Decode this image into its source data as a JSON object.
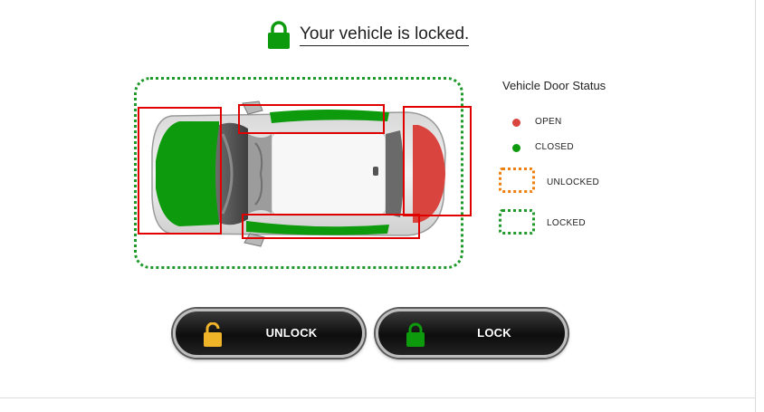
{
  "header": {
    "status_text": "Your vehicle is locked."
  },
  "legend": {
    "title": "Vehicle Door Status",
    "open_label": "OPEN",
    "closed_label": "CLOSED",
    "unlocked_label": "UNLOCKED",
    "locked_label": "LOCKED"
  },
  "colors": {
    "open": "#d9443f",
    "closed": "#0d9a0d",
    "unlocked": "#ee7f0e",
    "locked": "#1f9a2a",
    "highlight": "#e00000"
  },
  "doors": {
    "hood": "closed",
    "left_door": "closed",
    "right_door": "closed",
    "trunk": "open"
  },
  "buttons": {
    "unlock_label": "UNLOCK",
    "lock_label": "LOCK"
  }
}
